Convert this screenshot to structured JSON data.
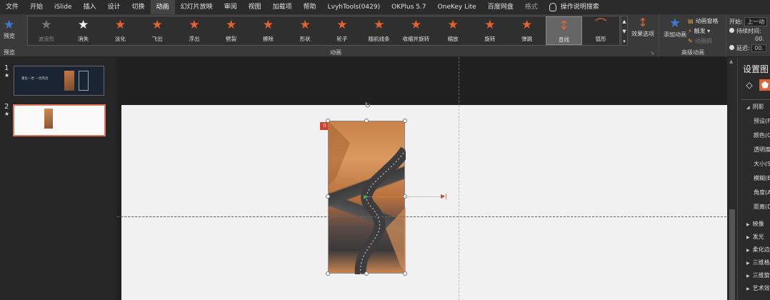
{
  "menu": {
    "items": [
      "文件",
      "开始",
      "iSlide",
      "插入",
      "设计",
      "切换",
      "动画",
      "幻灯片放映",
      "审阅",
      "视图",
      "加载项",
      "帮助",
      "LvyhTools(0429)",
      "OKPlus 5.7",
      "OneKey Lite",
      "百度网盘",
      "格式"
    ],
    "active_index": 6,
    "search_label": "操作说明搜索"
  },
  "ribbon": {
    "preview_label": "预览",
    "preview_group_label": "预览",
    "animations": [
      {
        "name": "波浪形",
        "color": "gray",
        "disabled": true
      },
      {
        "name": "消失",
        "color": "white"
      },
      {
        "name": "淡化",
        "color": "orange"
      },
      {
        "name": "飞出",
        "color": "orange"
      },
      {
        "name": "浮出",
        "color": "orange"
      },
      {
        "name": "劈裂",
        "color": "orange"
      },
      {
        "name": "擦除",
        "color": "orange"
      },
      {
        "name": "形状",
        "color": "orange"
      },
      {
        "name": "轮子",
        "color": "orange"
      },
      {
        "name": "随机线条",
        "color": "orange"
      },
      {
        "name": "收缩并旋转",
        "color": "orange"
      },
      {
        "name": "缩放",
        "color": "orange"
      },
      {
        "name": "旋转",
        "color": "orange"
      },
      {
        "name": "弹跳",
        "color": "orange"
      },
      {
        "name": "直线",
        "color": "orange",
        "selected": true
      },
      {
        "name": "弧形",
        "color": "orange"
      }
    ],
    "effect_options_label": "效果选项",
    "animation_group_label": "动画",
    "add_animation_label": "添加动画",
    "animation_pane_label": "动画窗格",
    "trigger_label": "触发",
    "animation_painter_label": "动画刷",
    "advanced_group_label": "高级动画",
    "start_label": "开始:",
    "start_value": "上一动",
    "duration_label": "持续时间:",
    "duration_value": "00.",
    "delay_label": "延迟:",
    "delay_value": "00."
  },
  "thumbnails": [
    {
      "number": "1",
      "star": "★",
      "text": "重生一世 一世风流"
    },
    {
      "number": "2",
      "star": "★"
    }
  ],
  "canvas": {
    "animation_tag": "0"
  },
  "pane": {
    "title": "设置图",
    "shadow_section": "阴影",
    "shadow_rows": [
      "预设(P)",
      "颜色(C)",
      "透明度(",
      "大小(S)",
      "模糊(B)",
      "角度(A)",
      "距离(D)"
    ],
    "sections": [
      "映像",
      "发光",
      "柔化边",
      "三维格",
      "三维旋",
      "艺术效"
    ]
  },
  "colors": {
    "accent_orange": "#e8612c",
    "selection_border": "#e2765a",
    "tag_red": "#c8432a"
  }
}
